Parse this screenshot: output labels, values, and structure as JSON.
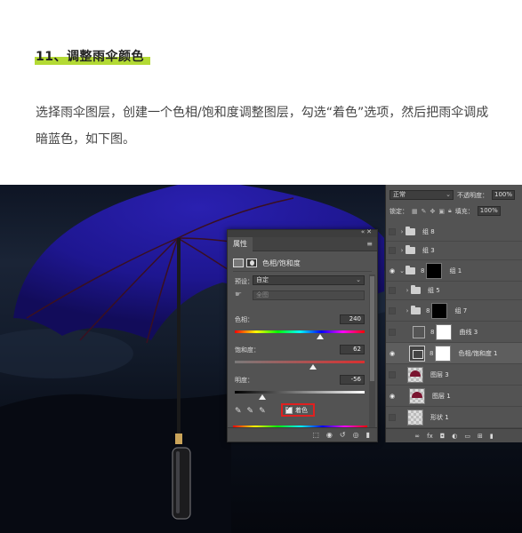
{
  "article": {
    "step_title": "11、调整雨伞颜色",
    "description": "选择雨伞图层，创建一个色相/饱和度调整图层，勾选“着色”选项，然后把雨伞调成暗蓝色，如下图。"
  },
  "properties_panel": {
    "tab": "属性",
    "adjustment_name": "色相/饱和度",
    "preset_label": "预设：",
    "preset_value": "自定",
    "channel_value": "全图",
    "hue_label": "色相：",
    "hue_value": "240",
    "saturation_label": "饱和度：",
    "saturation_value": "62",
    "lightness_label": "明度：",
    "lightness_value": "-56",
    "colorize_label": "着色",
    "colorize_checked": true,
    "colors": {
      "umbrella": "#1e1690",
      "colorize_highlight": "#e02020",
      "bottom_bar": "#2e2ab0"
    }
  },
  "layers_panel": {
    "blend_mode": "正常",
    "opacity_label": "不透明度：",
    "opacity_value": "100%",
    "lock_label": "锁定：",
    "fill_label": "填充：",
    "fill_value": "100%",
    "layers": [
      {
        "name": "组 8",
        "visible": false
      },
      {
        "name": "组 3",
        "visible": false
      },
      {
        "name": "组 1",
        "visible": true
      },
      {
        "name": "组 5",
        "visible": false
      },
      {
        "name": "组 7",
        "visible": false
      },
      {
        "name": "曲线 3",
        "visible": false
      },
      {
        "name": "色相/饱和度 1",
        "visible": true,
        "selected": true
      },
      {
        "name": "图层 3",
        "visible": false
      },
      {
        "name": "图层 1",
        "visible": true
      },
      {
        "name": "形状 1",
        "visible": false
      }
    ]
  },
  "icons": {
    "eye": "eye-icon",
    "folder": "folder-icon",
    "link": "link-icon",
    "eyedropper": "eyedropper-icon",
    "hand": "targeted-adjustment-icon"
  }
}
